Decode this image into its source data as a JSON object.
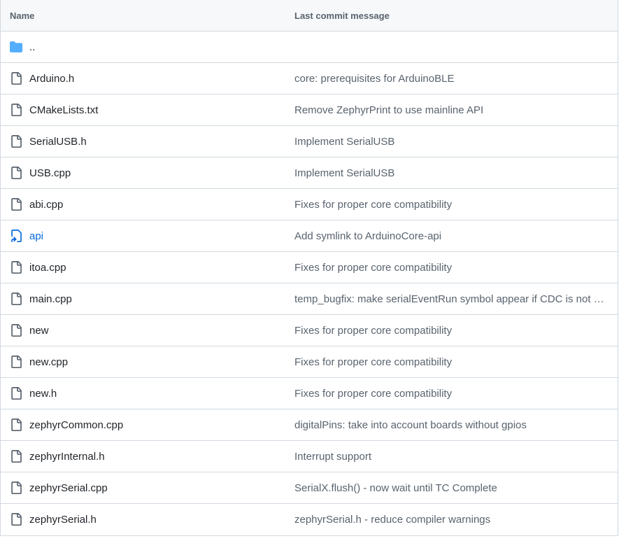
{
  "header": {
    "name_label": "Name",
    "message_label": "Last commit message"
  },
  "parent_row": {
    "name": "..",
    "icon": "folder-icon"
  },
  "files": [
    {
      "name": "Arduino.h",
      "message": "core: prerequisites for ArduinoBLE",
      "icon": "file-icon"
    },
    {
      "name": "CMakeLists.txt",
      "message": "Remove ZephyrPrint to use mainline API",
      "icon": "file-icon"
    },
    {
      "name": "SerialUSB.h",
      "message": "Implement SerialUSB",
      "icon": "file-icon"
    },
    {
      "name": "USB.cpp",
      "message": "Implement SerialUSB",
      "icon": "file-icon"
    },
    {
      "name": "abi.cpp",
      "message": "Fixes for proper core compatibility",
      "icon": "file-icon"
    },
    {
      "name": "api",
      "message": "Add symlink to ArduinoCore-api",
      "icon": "symlink-icon"
    },
    {
      "name": "itoa.cpp",
      "message": "Fixes for proper core compatibility",
      "icon": "file-icon"
    },
    {
      "name": "main.cpp",
      "message": "temp_bugfix: make serialEventRun symbol appear if CDC is not enabled",
      "icon": "file-icon"
    },
    {
      "name": "new",
      "message": "Fixes for proper core compatibility",
      "icon": "file-icon"
    },
    {
      "name": "new.cpp",
      "message": "Fixes for proper core compatibility",
      "icon": "file-icon"
    },
    {
      "name": "new.h",
      "message": "Fixes for proper core compatibility",
      "icon": "file-icon"
    },
    {
      "name": "zephyrCommon.cpp",
      "message": "digitalPins: take into account boards without gpios",
      "icon": "file-icon"
    },
    {
      "name": "zephyrInternal.h",
      "message": "Interrupt support",
      "icon": "file-icon"
    },
    {
      "name": "zephyrSerial.cpp",
      "message": "SerialX.flush() - now wait until TC Complete",
      "icon": "file-icon"
    },
    {
      "name": "zephyrSerial.h",
      "message": "zephyrSerial.h - reduce compiler warnings",
      "icon": "file-icon"
    }
  ],
  "colors": {
    "folder": "#54aeff",
    "link": "#0969da",
    "muted": "#59636e",
    "text": "#1f2328",
    "border": "#d1d9e0",
    "header_bg": "#f6f8fa"
  }
}
